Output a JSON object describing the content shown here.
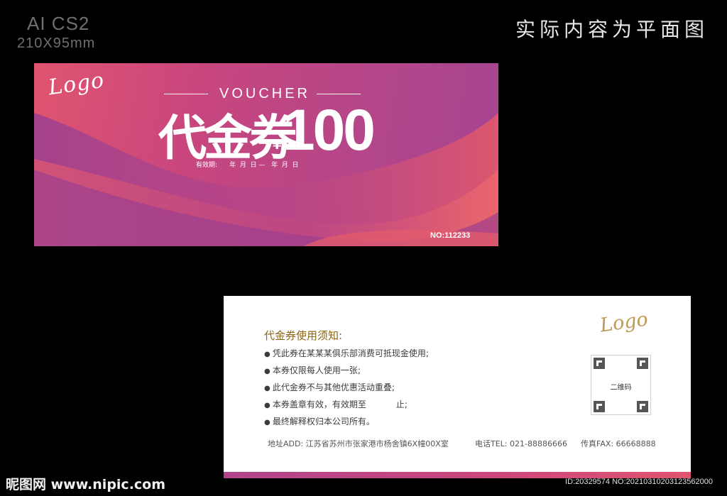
{
  "header": {
    "software": "AI CS2",
    "size": "210X95mm",
    "note": "实际内容为平面图"
  },
  "front": {
    "logo": "Logo",
    "voucher_word": "VOUCHER",
    "title": "代金券",
    "currency": "¥",
    "amount": "100",
    "validity": "有效期:      年  月  日 —   年  月  日",
    "serial": "NO:112233"
  },
  "back": {
    "logo": "Logo",
    "notes_title": "代金券使用须知:",
    "notes": [
      "凭此券在某某某俱乐部消费可抵现金使用;",
      "本券仅限每人使用一张;",
      "此代金券不与其他优惠活动重叠;",
      "本券盖章有效，有效期至           止;",
      "最终解释权归本公司所有。"
    ],
    "qr_label": "二维码",
    "address": "地址ADD: 江苏省苏州市张家港市杨舍镇6X幢00X室",
    "tel": "电话TEL: 021-88886666",
    "fax": "传真FAX: 66668888"
  },
  "watermark": {
    "site": "昵图网 www.nipic.com",
    "id": "ID:20329574 NO:20210310203123562000"
  },
  "colors": {
    "front_gradient_start": "#e0546f",
    "front_gradient_end": "#a54492",
    "notes_title": "#8c6414",
    "back_logo": "#c09a54"
  }
}
